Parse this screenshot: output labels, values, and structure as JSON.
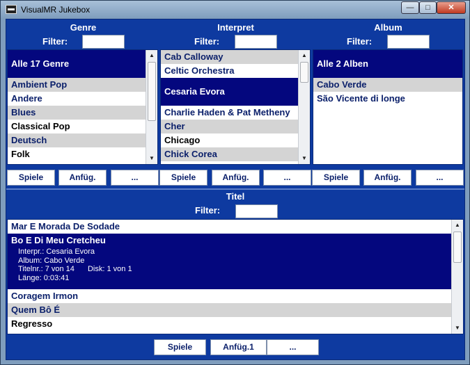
{
  "window": {
    "title": "VisualMR Jukebox",
    "controls": {
      "minimize": "—",
      "maximize": "□",
      "close": "✕"
    }
  },
  "genre": {
    "title": "Genre",
    "filter_label": "Filter:",
    "filter_value": "",
    "header_item": "Alle 17 Genre",
    "items": [
      "Ambient Pop",
      "Andere",
      "Blues",
      "Classical Pop",
      "Deutsch",
      "Folk"
    ]
  },
  "interpret": {
    "title": "Interpret",
    "filter_label": "Filter:",
    "filter_value": "",
    "items": [
      "Cab Calloway",
      "Celtic Orchestra",
      "Cesaria Evora",
      "Charlie Haden & Pat Metheny",
      "Cher",
      "Chicago",
      "Chick Corea"
    ]
  },
  "album": {
    "title": "Album",
    "filter_label": "Filter:",
    "filter_value": "",
    "header_item": "Alle 2 Alben",
    "items": [
      "Cabo Verde",
      "São Vicente di longe"
    ]
  },
  "buttons": {
    "play": "Spiele",
    "enqueue": "Anfüg.",
    "more": "..."
  },
  "titel": {
    "title": "Titel",
    "filter_label": "Filter:",
    "filter_value": "",
    "items_before": [
      "Mar E Morada De Sodade"
    ],
    "selected": {
      "name": "Bo E Di Meu Cretcheu",
      "interpret": "Interpr.: Cesaria Evora",
      "album": "Album: Cabo Verde",
      "track": "Titelnr.: 7 von 14",
      "disk": "Disk: 1 von 1",
      "length": "Länge: 0:03:41"
    },
    "items_after": [
      "Coragem Irmon",
      "Quem Bô É",
      "Regresso"
    ],
    "play_label": "Spiele",
    "enqueue_label": "Anfüg.1",
    "more_label": "..."
  }
}
